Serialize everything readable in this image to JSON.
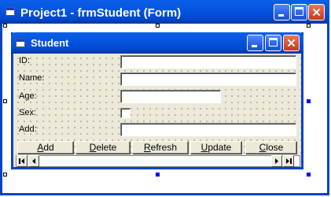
{
  "outer_window": {
    "title": "Project1 - frmStudent (Form)"
  },
  "form_window": {
    "title": "Student"
  },
  "fields": {
    "id_label": "ID:",
    "name_label": "Name:",
    "age_label": "Age:",
    "sex_label": "Sex:",
    "add_label": "Add:"
  },
  "buttons": {
    "add": {
      "first": "A",
      "rest": "dd"
    },
    "delete": {
      "first": "D",
      "rest": "elete"
    },
    "refresh": {
      "first": "R",
      "rest": "efresh"
    },
    "update": {
      "first": "U",
      "rest": "pdate"
    },
    "close": {
      "first": "C",
      "rest": "lose"
    }
  },
  "colors": {
    "title_bar": "#0454e0",
    "close_button": "#d74f30",
    "form_face": "#ece9d8",
    "selection_handle": "#0000ff"
  },
  "icons": {
    "outer_app": "vb-form-icon",
    "form_app": "vb-form-icon",
    "minimize": "minimize-icon",
    "maximize": "maximize-icon",
    "close": "close-icon",
    "first_record": "first-record-icon",
    "prev_record": "prev-record-icon",
    "next_record": "next-record-icon",
    "last_record": "last-record-icon"
  }
}
